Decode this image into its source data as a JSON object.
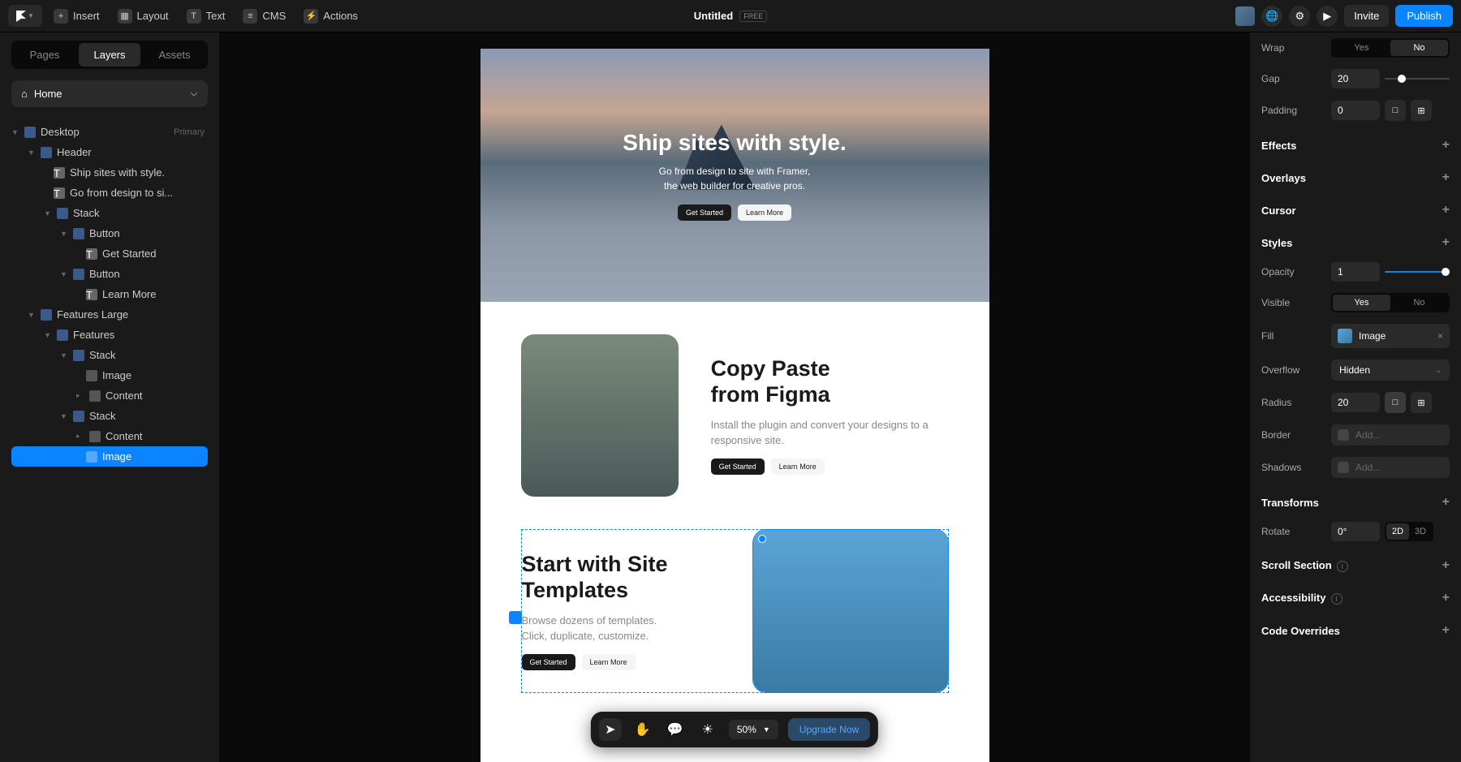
{
  "topbar": {
    "insert": "Insert",
    "layout": "Layout",
    "text": "Text",
    "cms": "CMS",
    "actions": "Actions",
    "title": "Untitled",
    "badge": "FREE",
    "invite": "Invite",
    "publish": "Publish"
  },
  "leftPanel": {
    "tabs": {
      "pages": "Pages",
      "layers": "Layers",
      "assets": "Assets"
    },
    "home": "Home",
    "tree": {
      "desktop": "Desktop",
      "primary": "Primary",
      "header": "Header",
      "t1": "Ship sites with style.",
      "t2": "Go from design to si...",
      "stack": "Stack",
      "button": "Button",
      "getStarted": "Get Started",
      "learnMore": "Learn More",
      "featuresLarge": "Features Large",
      "features": "Features",
      "image": "Image",
      "content": "Content"
    }
  },
  "canvas": {
    "hero": {
      "title": "Ship sites with style.",
      "line1": "Go from design to site with Framer,",
      "line2": "the web builder for creative pros.",
      "btn1": "Get Started",
      "btn2": "Learn More"
    },
    "feat1": {
      "title1": "Copy Paste",
      "title2": "from Figma",
      "desc": "Install the plugin and convert your designs to a responsive site.",
      "btn1": "Get Started",
      "btn2": "Learn More"
    },
    "feat2": {
      "title1": "Start with Site",
      "title2": "Templates",
      "desc1": "Browse dozens of templates.",
      "desc2": "Click, duplicate, customize.",
      "btn1": "Get Started",
      "btn2": "Learn More"
    }
  },
  "bottomBar": {
    "zoom": "50%",
    "upgrade": "Upgrade Now"
  },
  "rightPanel": {
    "wrap": {
      "label": "Wrap",
      "yes": "Yes",
      "no": "No"
    },
    "gap": {
      "label": "Gap",
      "value": "20"
    },
    "padding": {
      "label": "Padding",
      "value": "0"
    },
    "effects": "Effects",
    "overlays": "Overlays",
    "cursor": "Cursor",
    "styles": "Styles",
    "opacity": {
      "label": "Opacity",
      "value": "1"
    },
    "visible": {
      "label": "Visible",
      "yes": "Yes",
      "no": "No"
    },
    "fill": {
      "label": "Fill",
      "value": "Image"
    },
    "overflow": {
      "label": "Overflow",
      "value": "Hidden"
    },
    "radius": {
      "label": "Radius",
      "value": "20"
    },
    "border": {
      "label": "Border",
      "placeholder": "Add..."
    },
    "shadows": {
      "label": "Shadows",
      "placeholder": "Add..."
    },
    "transforms": "Transforms",
    "rotate": {
      "label": "Rotate",
      "value": "0°",
      "d2": "2D",
      "d3": "3D"
    },
    "scrollSection": "Scroll Section",
    "accessibility": "Accessibility",
    "codeOverrides": "Code Overrides"
  }
}
